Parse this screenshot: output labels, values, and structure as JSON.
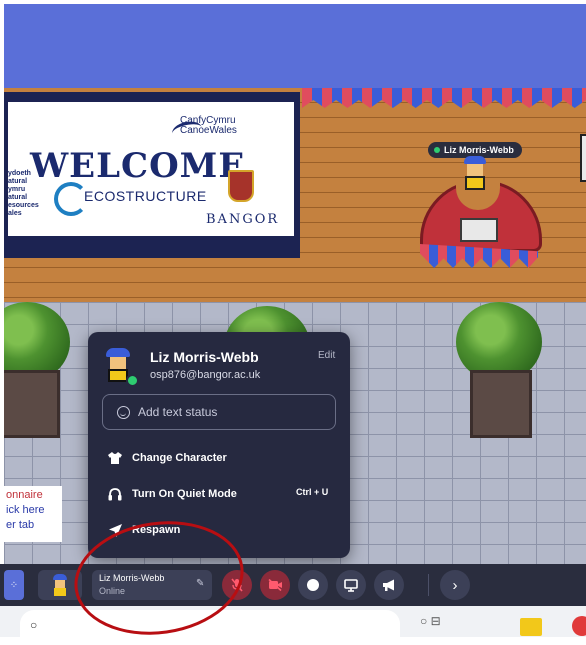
{
  "scene": {
    "player_nametag": "Liz Morris-Webb",
    "banner": {
      "welcome": "WELCOME",
      "cymru_line1": "CanfyCymru",
      "cymru_line2": "CanoeWales",
      "eco": "ECOSTRUCTURE",
      "bangor": "BANGOR",
      "left_text": "ydoeth\natural\nymru\natural\nesources\nales"
    },
    "side_card": {
      "line1": "onnaire",
      "line2": "ick here",
      "line3": "er tab"
    }
  },
  "profile_popup": {
    "name": "Liz Morris-Webb",
    "email": "osp876@bangor.ac.uk",
    "edit_label": "Edit",
    "status_placeholder": "Add text status",
    "menu": [
      {
        "label": "Change Character",
        "icon": "shirt-icon"
      },
      {
        "label": "Turn On Quiet Mode",
        "icon": "headphones-icon",
        "shortcut": "Ctrl + U"
      },
      {
        "label": "Respawn",
        "icon": "navigation-arrow-icon"
      }
    ]
  },
  "bottom_bar": {
    "user_name": "Liz Morris-Webb",
    "user_status": "Online",
    "mic_state": "muted",
    "camera_state": "off",
    "accent_color": "#5a6fd8",
    "bar_color": "#2a2d3e",
    "muted_color": "#ff5a6e"
  }
}
